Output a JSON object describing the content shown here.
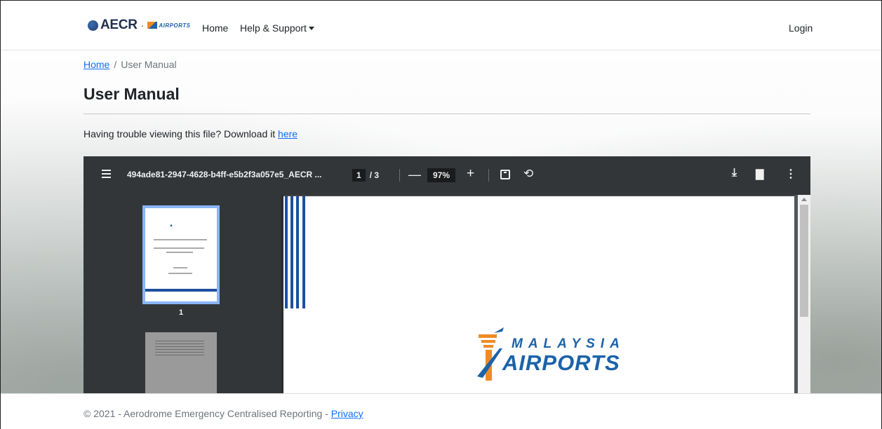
{
  "navbar": {
    "brand_text": "AECR",
    "brand_separator": "·",
    "brand_partner": "AIRPORTS",
    "home_label": "Home",
    "help_label": "Help & Support",
    "login_label": "Login"
  },
  "breadcrumb": {
    "home": "Home",
    "separator": "/",
    "current": "User Manual"
  },
  "page": {
    "title": "User Manual",
    "notice_text": "Having trouble viewing this file? Download it ",
    "notice_link": "here"
  },
  "pdf_viewer": {
    "filename": "494ade81-2947-4628-b4ff-e5b2f3a057e5_AECR ...",
    "current_page": "1",
    "page_separator": "/",
    "total_pages": "3",
    "zoom": "97%",
    "thumbnail_1_label": "1",
    "logo_line1": "MALAYSIA",
    "logo_line2": "AIRPORTS",
    "colors": {
      "toolbar": "#323639",
      "canvas": "#525659",
      "thumb_highlight": "#8ab4f8",
      "brand_blue": "#1d62a8",
      "brand_orange": "#f08a24"
    }
  },
  "footer": {
    "text": "© 2021 - Aerodrome Emergency Centralised Reporting - ",
    "privacy_link": "Privacy"
  },
  "icons": [
    "globe-icon",
    "caret-down-icon",
    "menu-icon",
    "zoom-out-icon",
    "zoom-in-icon",
    "fit-page-icon",
    "rotate-icon",
    "download-icon",
    "print-icon",
    "more-icon"
  ]
}
